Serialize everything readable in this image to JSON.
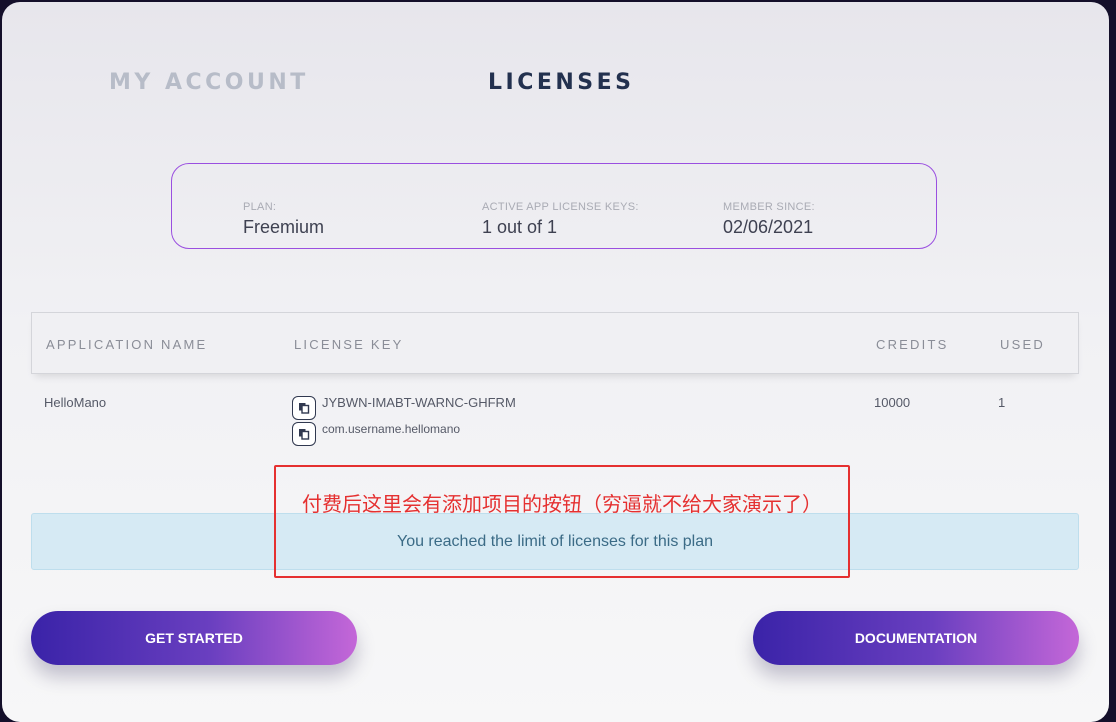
{
  "tabs": {
    "my_account": "MY ACCOUNT",
    "licenses": "LICENSES"
  },
  "summary": {
    "plan_label": "PLAN:",
    "plan_value": "Freemium",
    "keys_label": "ACTIVE APP LICENSE KEYS:",
    "keys_value": "1 out of 1",
    "since_label": "MEMBER SINCE:",
    "since_value": "02/06/2021"
  },
  "table": {
    "headers": [
      "APPLICATION NAME",
      "LICENSE KEY",
      "CREDITS",
      "USED"
    ],
    "rows": [
      {
        "app_name": "HelloMano",
        "license_key": "JYBWN-IMABT-WARNC-GHFRM",
        "package": "com.username.hellomano",
        "credits": "10000",
        "used": "1"
      }
    ]
  },
  "notice": "You reached the limit of licenses for this plan",
  "annotation": "付费后这里会有添加项目的按钮（穷逼就不给大家演示了）",
  "buttons": {
    "get_started": "GET STARTED",
    "documentation": "DOCUMENTATION"
  },
  "colors": {
    "accent_purple": "#9a4fe0",
    "gradient_start": "#3a23a8",
    "gradient_end": "#c467d8",
    "annotation_red": "#e53030",
    "notice_bg": "#d6eaf4"
  },
  "icons": {
    "copy": "copy-icon"
  }
}
